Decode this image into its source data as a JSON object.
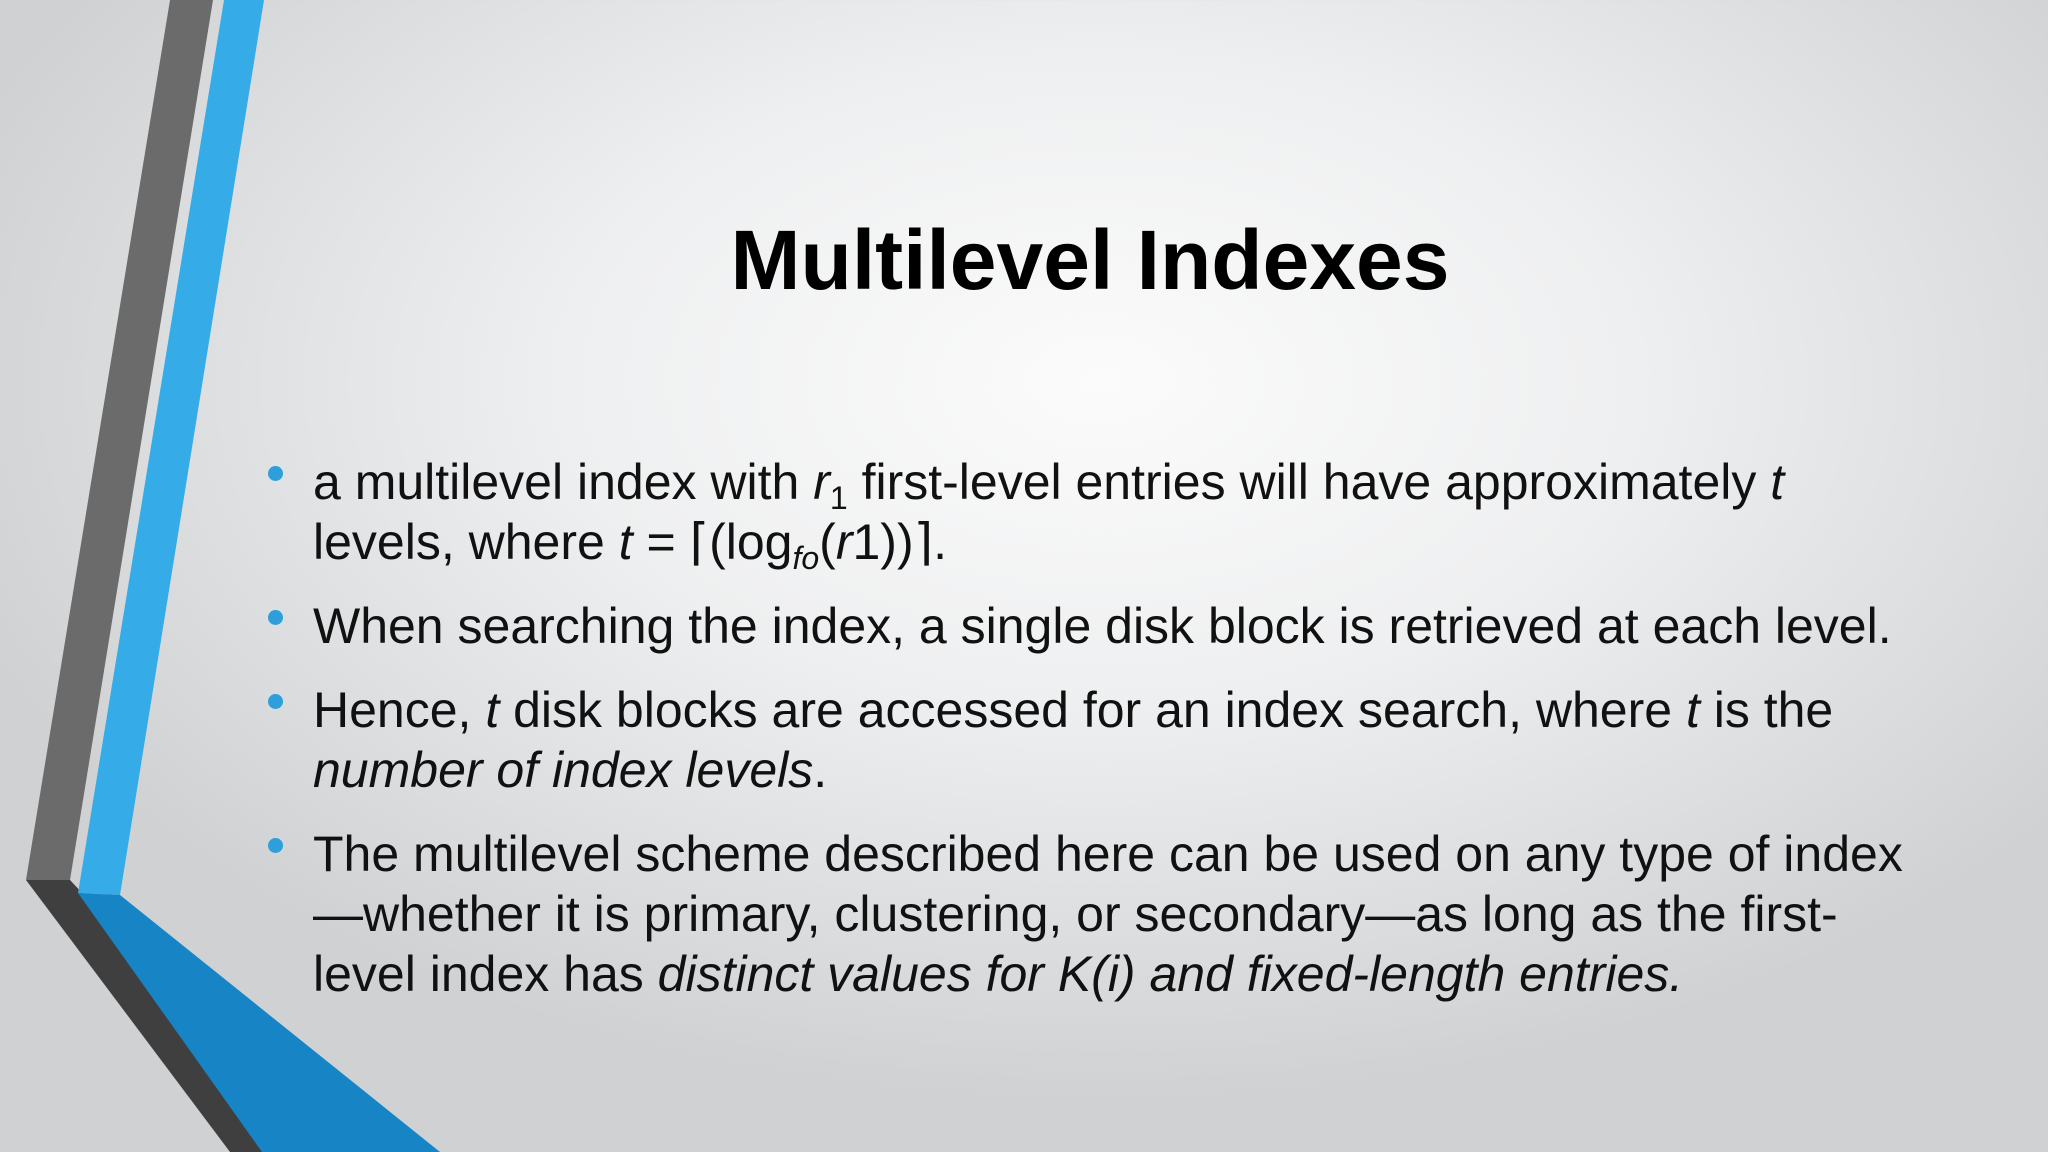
{
  "slide": {
    "title": "Multilevel Indexes",
    "colors": {
      "accent_blue": "#35abe8",
      "accent_dark_blue": "#1684c5",
      "accent_gray": "#6b6b6b",
      "bullet": "#2e9fdb"
    },
    "bullets": [
      {
        "parts": {
          "a": "a multilevel index with ",
          "r": "r",
          "r_sub": "1",
          "b": " first-level entries will have approximately ",
          "t1": "t",
          "c": " levels, where ",
          "t2": "t",
          "d": " = ⌈(log",
          "fo": "fo",
          "e": "(",
          "r2": "r",
          "f": "1))⌉."
        }
      },
      {
        "text": "When searching the index, a single disk block is retrieved at each level."
      },
      {
        "parts": {
          "a": "Hence, ",
          "t1": "t",
          "b": " disk blocks are accessed for an index search, where ",
          "t2": "t",
          "c": " is the ",
          "d": "number of index levels",
          "e": "."
        }
      },
      {
        "parts": {
          "a": "The multilevel scheme described here can be used on any type of index—whether it is primary, clustering, or secondary—as long as the first-level index has ",
          "b": "distinct values for K(i) and fixed-length entries."
        }
      }
    ]
  }
}
